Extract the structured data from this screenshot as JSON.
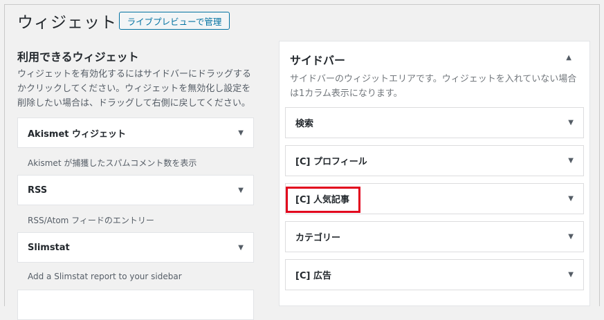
{
  "page": {
    "title": "ウィジェット",
    "manage_button": "ライブプレビューで管理"
  },
  "available": {
    "title": "利用できるウィジェット",
    "description": "ウィジェットを有効化するにはサイドバーにドラッグするかクリックしてください。ウィジェットを無効化し設定を削除したい場合は、ドラッグして右側に戻してください。",
    "widgets": [
      {
        "name": "Akismet ウィジェット",
        "desc": "Akismet が捕獲したスパムコメント数を表示"
      },
      {
        "name": "RSS",
        "desc": "RSS/Atom フィードのエントリー"
      },
      {
        "name": "Slimstat",
        "desc": "Add a Slimstat report to your sidebar"
      }
    ]
  },
  "sidebar": {
    "title": "サイドバー",
    "description": "サイドバーのウィジットエリアです。ウィジェットを入れていない場合は1カラム表示になります。",
    "items": [
      {
        "name": "検索"
      },
      {
        "name": "[C] プロフィール"
      },
      {
        "name": "[C] 人気記事"
      },
      {
        "name": "カテゴリー"
      },
      {
        "name": "[C] 広告"
      }
    ]
  },
  "icons": {
    "expand": "arrow-down-icon",
    "collapse": "arrow-up-icon"
  },
  "colors": {
    "highlight": "#e2001c",
    "accent": "#0071a1"
  }
}
